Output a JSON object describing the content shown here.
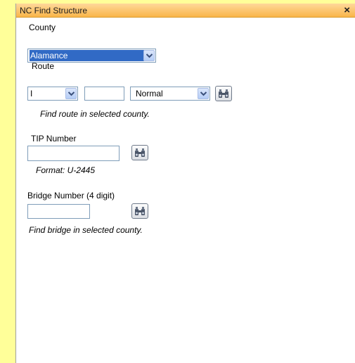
{
  "window": {
    "title": "NC Find Structure",
    "close_glyph": "×"
  },
  "county": {
    "label": "County",
    "selected": "Alamance"
  },
  "route": {
    "label": "Route",
    "type_selected": "I",
    "number_value": "",
    "modifier_selected": "Normal",
    "hint": "Find route in selected county."
  },
  "tip": {
    "label": "TIP Number",
    "value": "",
    "hint": "Format:  U-2445"
  },
  "bridge": {
    "label": "Bridge Number (4 digit)",
    "value": "",
    "hint": "Find bridge in selected county."
  },
  "icons": {
    "dropdown": "chevron-down-icon",
    "search": "binoculars-icon"
  },
  "colors": {
    "background": "#ffff99",
    "title_bar": "#f9b54a",
    "selection": "#316ac5"
  }
}
